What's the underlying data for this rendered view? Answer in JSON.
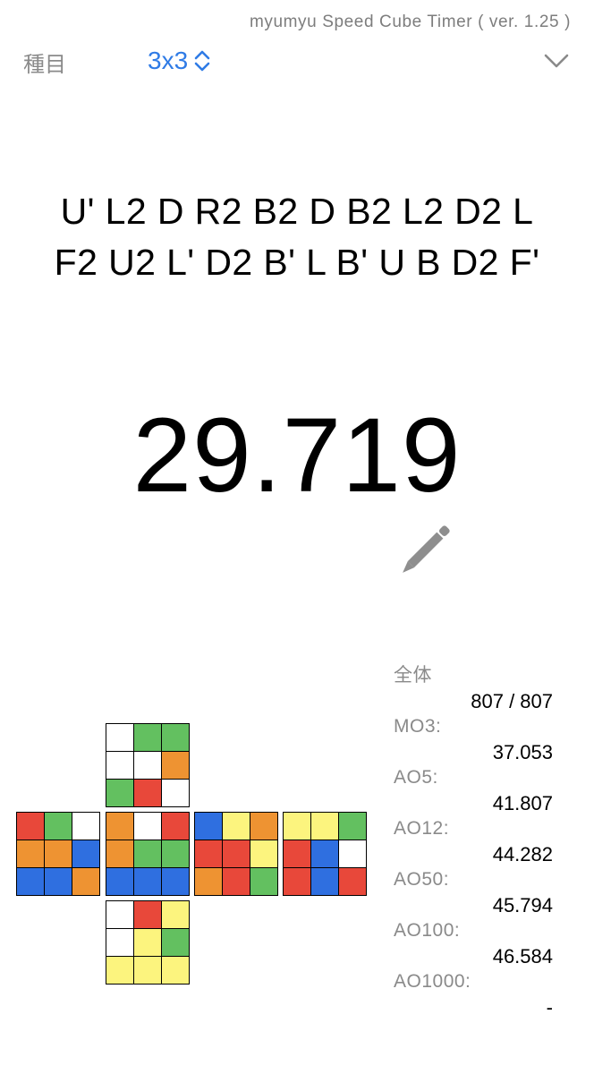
{
  "app": {
    "version": "myumyu Speed Cube Timer ( ver. 1.25 )"
  },
  "header": {
    "event_label": "種目",
    "event_value": "3x3"
  },
  "scramble": {
    "line1": "U' L2 D R2 B2 D B2 L2 D2 L",
    "line2": "F2 U2 L' D2 B' L B' U B D2 F'"
  },
  "timer": {
    "time": "29.719"
  },
  "colors": {
    "W": "#ffffff",
    "G": "#63c060",
    "R": "#e8483a",
    "O": "#ee9332",
    "B": "#2f6fe0",
    "Y": "#fcf47e",
    "accent": "#2f7be6"
  },
  "cube": {
    "U": [
      "W",
      "G",
      "G",
      "W",
      "W",
      "O",
      "G",
      "R",
      "W"
    ],
    "L": [
      "R",
      "G",
      "W",
      "O",
      "O",
      "B",
      "B",
      "B",
      "O"
    ],
    "F": [
      "O",
      "W",
      "R",
      "O",
      "G",
      "G",
      "B",
      "B",
      "B"
    ],
    "R": [
      "B",
      "Y",
      "O",
      "R",
      "R",
      "Y",
      "O",
      "R",
      "G"
    ],
    "B": [
      "Y",
      "Y",
      "G",
      "R",
      "B",
      "W",
      "R",
      "B",
      "R"
    ],
    "D": [
      "W",
      "R",
      "Y",
      "W",
      "Y",
      "G",
      "Y",
      "Y",
      "Y"
    ]
  },
  "stats": [
    {
      "label": "全体",
      "value": "807 / 807"
    },
    {
      "label": "MO3:",
      "value": "37.053"
    },
    {
      "label": "AO5:",
      "value": "41.807"
    },
    {
      "label": "AO12:",
      "value": "44.282"
    },
    {
      "label": "AO50:",
      "value": "45.794"
    },
    {
      "label": "AO100:",
      "value": "46.584"
    },
    {
      "label": "AO1000:",
      "value": "-"
    }
  ]
}
